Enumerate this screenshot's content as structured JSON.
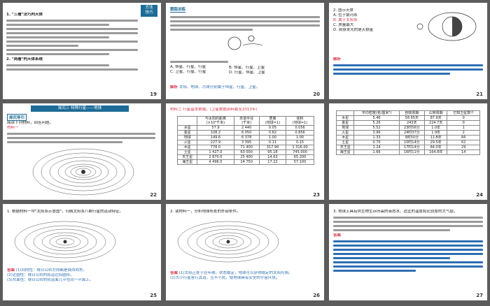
{
  "pages": {
    "p19": "19",
    "p20": "20",
    "p21": "21",
    "p22": "22",
    "p23": "23",
    "p24": "24",
    "p25": "25",
    "p26": "26",
    "p27": "27"
  },
  "s19": {
    "badge": "方法\n技巧",
    "heading1": "1. \"三看\"法巧判天体",
    "heading2": "2. \"两看\"判天体系统"
  },
  "s20": {
    "tag": "跟踪训练",
    "options_a": "A. 恒星、行星、行星",
    "options_b": "B. 恒星、行星、卫星",
    "options_c": "C. 卫星、行星、行星",
    "options_d": "D. 行星、恒星、卫星",
    "answer_label": "解析",
    "answer_text": "太阳、地球、月球分别属于恒星、行星、卫星。"
  },
  "s21": {
    "q": "2. 图示天体",
    "a": "A. 位于银河系",
    "b": "B. 属于太阳系",
    "c": "C. 质量最大",
    "d": "D. 自身发光的是天狼星",
    "answer_label": "解析"
  },
  "s22": {
    "title": "探究三   特殊行星——地球",
    "guide": "探究导引",
    "intro": "阅读下列材料，回答问题。",
    "material": "材料一"
  },
  "s23": {
    "caption": "材料二  行星基本数据。(卫星数据资料截至2013年)",
    "headers": [
      "",
      "与太阳的距离\n(×10⁶千米)",
      "赤道半径\n(千米)",
      "质量\n(地球=1)",
      "体积\n(地球=1)"
    ],
    "rows": [
      [
        "水星",
        "57.9",
        "2 440",
        "0.05",
        "0.056"
      ],
      [
        "金星",
        "108.2",
        "6 050",
        "0.82",
        "0.856"
      ],
      [
        "地球",
        "149.6",
        "6 378",
        "1.00",
        "1.00"
      ],
      [
        "火星",
        "227.9",
        "3 395",
        "0.11",
        "0.15"
      ],
      [
        "木星",
        "778.0",
        "71 400",
        "317.94",
        "1 316.00"
      ],
      [
        "土星",
        "1 427.0",
        "60 000",
        "95.18",
        "745.000"
      ],
      [
        "天王星",
        "2 870.0",
        "25 400",
        "14.63",
        "65.200"
      ],
      [
        "海王星",
        "4 496.0",
        "24 750",
        "17.22",
        "57.100"
      ]
    ]
  },
  "s24": {
    "headers": [
      "",
      "平均密度(克/厘米³)",
      "自转周期",
      "公转周期",
      "已知卫星数个"
    ],
    "rows": [
      [
        "水星",
        "5.46",
        "58.65天",
        "87.9天",
        "0"
      ],
      [
        "金星",
        "5.26",
        "243天",
        "224.7天",
        "0"
      ],
      [
        "地球",
        "5.52",
        "23时56分",
        "1.0年",
        "1"
      ],
      [
        "火星",
        "3.96",
        "24时37分",
        "1.9年",
        "2"
      ],
      [
        "木星",
        "1.33",
        "9时50分",
        "11.8年",
        "66"
      ],
      [
        "土星",
        "0.70",
        "10时14分",
        "29.5年",
        "62"
      ],
      [
        "天王星",
        "1.24",
        "17时14分",
        "84.0年",
        "29"
      ],
      [
        "海王星",
        "1.66",
        "16时11分",
        "164.8年",
        "14"
      ]
    ]
  },
  "s25": {
    "q": "1. 根据材料一中\"太阳系示意图\"，归纳太阳系八颗行星的运动特征。",
    "answer_label": "答案",
    "a1": "(1)同向性：绕日公转方向都是自西向东。",
    "a2": "(2)近圆性：绕日公转的轨道近似圆形。",
    "a3": "(3)共面性：绕日公转的轨道面几乎在同一平面上。"
  },
  "s26": {
    "q": "2. 读材料一，分析地球所处的外部条件。",
    "answer_label": "答案",
    "a1": "(1)太阳正处于壮年期，状态稳定，地球可以获得稳定的太阳光照。",
    "a2": "(2)大小行星各行其道，互不干扰，使地球具有安全的宇宙环境。"
  },
  "s27": {
    "q": "3. 地球上具有供生物生存所需的液态水、适宜的温度和比较厚的大气层。",
    "answer_label": "答案"
  }
}
